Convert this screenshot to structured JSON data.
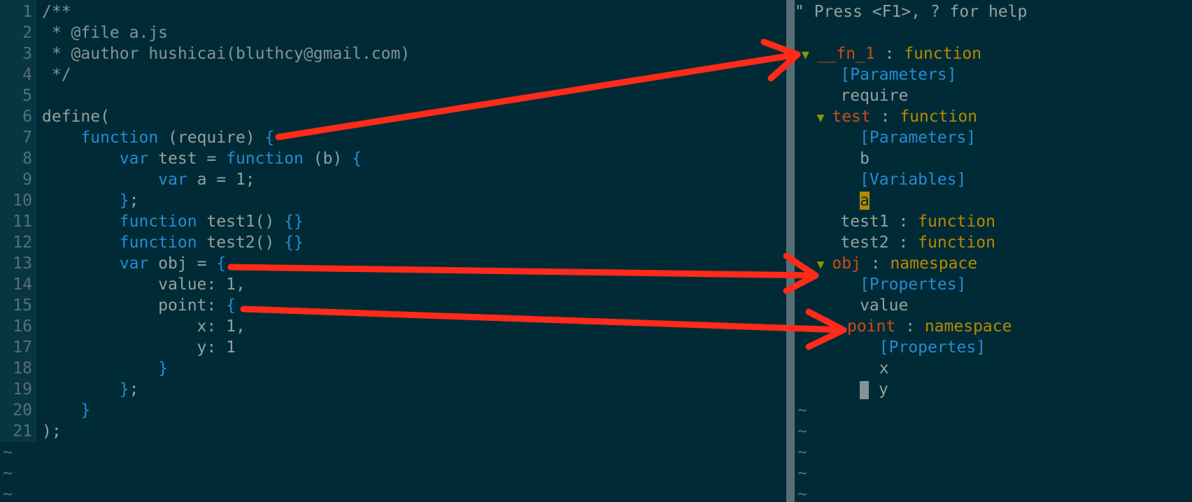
{
  "editor": {
    "line_numbers": [
      "1",
      "2",
      "3",
      "4",
      "5",
      "6",
      "7",
      "8",
      "9",
      "10",
      "11",
      "12",
      "13",
      "14",
      "15",
      "16",
      "17",
      "18",
      "19",
      "20",
      "21"
    ],
    "code": [
      [
        {
          "t": "/**",
          "c": "comment"
        }
      ],
      [
        {
          "t": " * @file a.js",
          "c": "comment"
        }
      ],
      [
        {
          "t": " * @author hushicai(bluthcy@gmail.com)",
          "c": "comment"
        }
      ],
      [
        {
          "t": " */",
          "c": "comment"
        }
      ],
      [],
      [
        {
          "t": "define(",
          "c": "plain"
        }
      ],
      [
        {
          "t": "    function",
          "c": "kw"
        },
        {
          "t": " (require) ",
          "c": "plain"
        },
        {
          "t": "{",
          "c": "brace"
        }
      ],
      [
        {
          "t": "        var",
          "c": "kw"
        },
        {
          "t": " test = ",
          "c": "plain"
        },
        {
          "t": "function",
          "c": "kw"
        },
        {
          "t": " (b) ",
          "c": "plain"
        },
        {
          "t": "{",
          "c": "brace"
        }
      ],
      [
        {
          "t": "            var",
          "c": "kw"
        },
        {
          "t": " a = 1;",
          "c": "plain"
        }
      ],
      [
        {
          "t": "        }",
          "c": "brace"
        },
        {
          "t": ";",
          "c": "plain"
        }
      ],
      [
        {
          "t": "        function",
          "c": "kw"
        },
        {
          "t": " test1() ",
          "c": "plain"
        },
        {
          "t": "{}",
          "c": "brace"
        }
      ],
      [
        {
          "t": "        function",
          "c": "kw"
        },
        {
          "t": " test2() ",
          "c": "plain"
        },
        {
          "t": "{}",
          "c": "brace"
        }
      ],
      [
        {
          "t": "        var",
          "c": "kw"
        },
        {
          "t": " obj = ",
          "c": "plain"
        },
        {
          "t": "{",
          "c": "brace"
        }
      ],
      [
        {
          "t": "            value: 1,",
          "c": "plain"
        }
      ],
      [
        {
          "t": "            point: ",
          "c": "plain"
        },
        {
          "t": "{",
          "c": "brace"
        }
      ],
      [
        {
          "t": "                x: 1,",
          "c": "plain"
        }
      ],
      [
        {
          "t": "                y: 1",
          "c": "plain"
        }
      ],
      [
        {
          "t": "            }",
          "c": "brace"
        }
      ],
      [
        {
          "t": "        }",
          "c": "brace"
        },
        {
          "t": ";",
          "c": "plain"
        }
      ],
      [
        {
          "t": "    }",
          "c": "brace"
        }
      ],
      [
        {
          "t": ");",
          "c": "plain"
        }
      ]
    ],
    "tildes": [
      "~",
      "~",
      "~"
    ]
  },
  "tagbar": {
    "help_text": "\" Press <F1>, ? for help",
    "tree": [
      [
        {
          "t": "",
          "c": "plain"
        }
      ],
      [
        {
          "t": "▼ ",
          "c": "arrow"
        },
        {
          "t": "__fn_1",
          "c": "orange"
        },
        {
          "t": " : ",
          "c": "plain"
        },
        {
          "t": "function",
          "c": "yellow"
        }
      ],
      [
        {
          "t": "    [Parameters]",
          "c": "blue"
        }
      ],
      [
        {
          "t": "    require",
          "c": "plain"
        }
      ],
      [
        {
          "t": "  ▼ ",
          "c": "arrow"
        },
        {
          "t": "test",
          "c": "orange"
        },
        {
          "t": " : ",
          "c": "plain"
        },
        {
          "t": "function",
          "c": "yellow"
        }
      ],
      [
        {
          "t": "      [Parameters]",
          "c": "blue"
        }
      ],
      [
        {
          "t": "      b",
          "c": "plain"
        }
      ],
      [
        {
          "t": "      [Variables]",
          "c": "blue"
        }
      ],
      [
        {
          "t": "      ",
          "c": "plain"
        },
        {
          "t": "a",
          "c": "hl"
        }
      ],
      [
        {
          "t": "    test1",
          "c": "plain"
        },
        {
          "t": " : ",
          "c": "plain"
        },
        {
          "t": "function",
          "c": "yellow"
        }
      ],
      [
        {
          "t": "    test2",
          "c": "plain"
        },
        {
          "t": " : ",
          "c": "plain"
        },
        {
          "t": "function",
          "c": "yellow"
        }
      ],
      [
        {
          "t": "  ▼ ",
          "c": "arrow"
        },
        {
          "t": "obj",
          "c": "orange"
        },
        {
          "t": " : ",
          "c": "plain"
        },
        {
          "t": "namespace",
          "c": "yellow"
        }
      ],
      [
        {
          "t": "      [Propertes]",
          "c": "blue"
        }
      ],
      [
        {
          "t": "      value",
          "c": "plain"
        }
      ],
      [
        {
          "t": "    ▼ ",
          "c": "arrow"
        },
        {
          "t": "point",
          "c": "orange"
        },
        {
          "t": " : ",
          "c": "plain"
        },
        {
          "t": "namespace",
          "c": "yellow"
        }
      ],
      [
        {
          "t": "        [Propertes]",
          "c": "blue"
        }
      ],
      [
        {
          "t": "        x",
          "c": "plain"
        }
      ],
      [
        {
          "t": "      ",
          "c": "plain"
        },
        {
          "t": "",
          "c": "cursor"
        },
        {
          "t": " y",
          "c": "plain"
        }
      ]
    ],
    "tildes": [
      "~",
      "~",
      "~",
      "~",
      "~"
    ]
  },
  "colors": {
    "background": "#002b36",
    "gutter": "#073642",
    "divider": "#586e75",
    "annotation_arrow": "#ff2a1a"
  }
}
